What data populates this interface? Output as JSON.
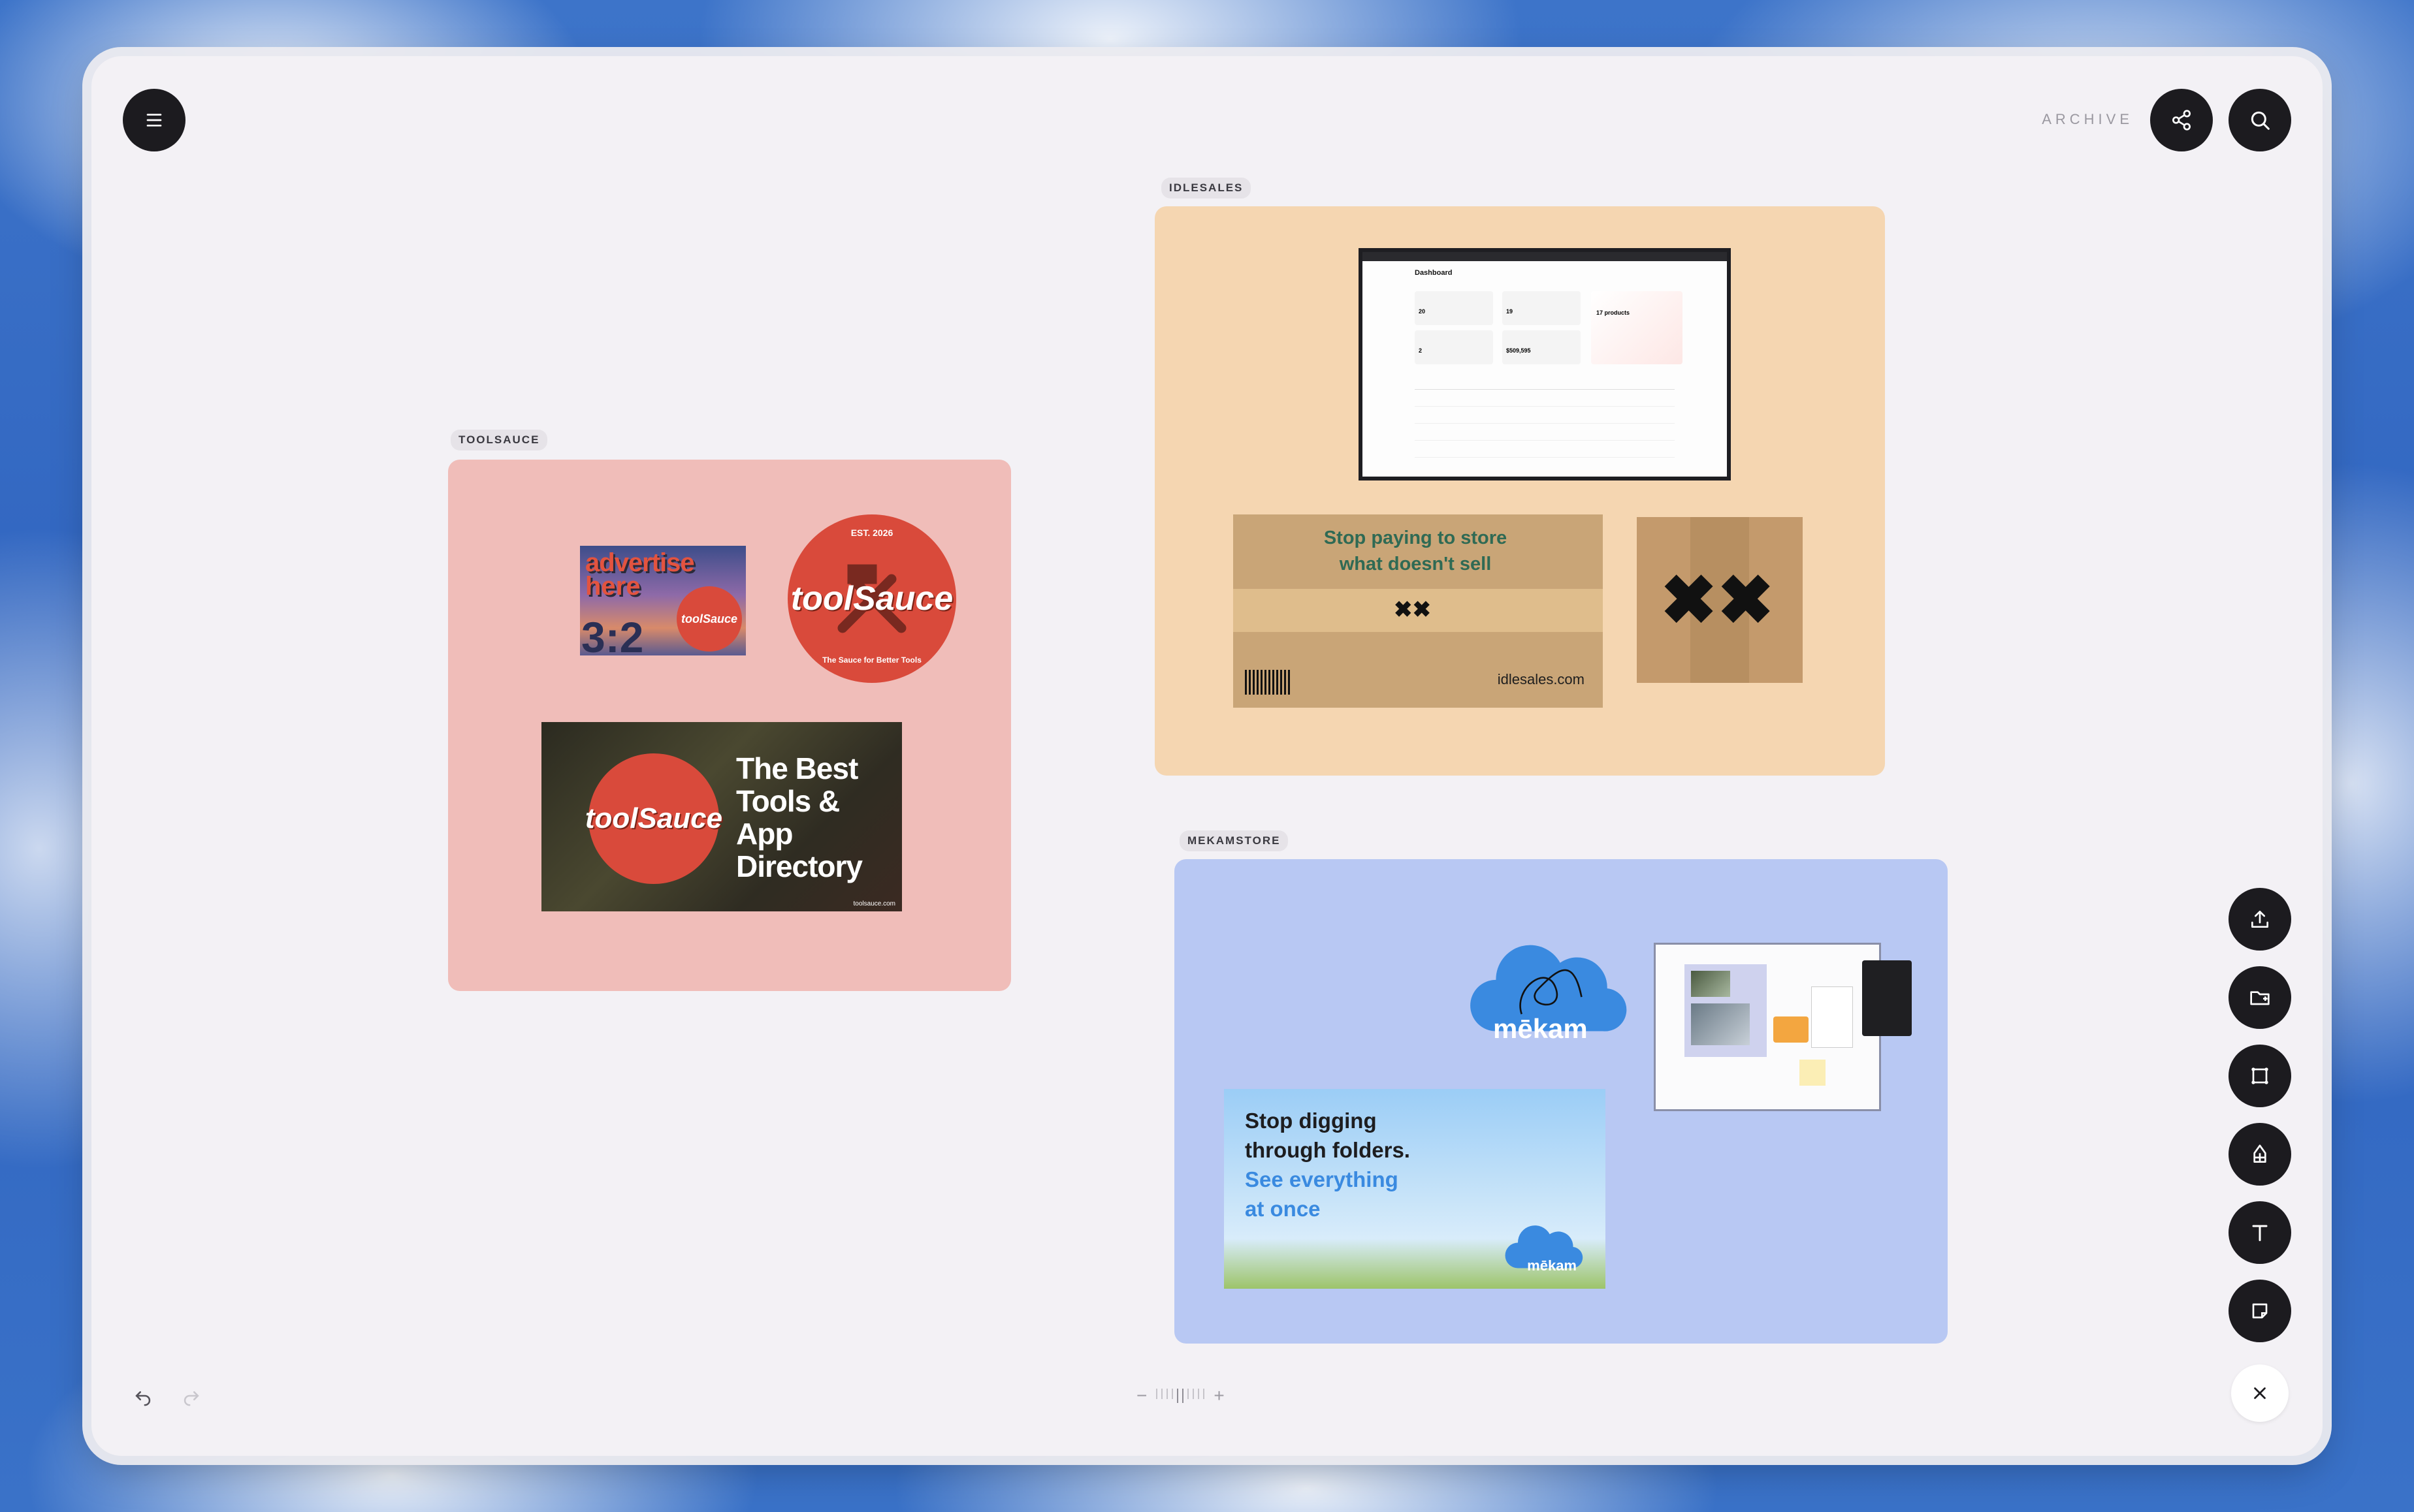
{
  "header": {
    "archive_label": "ARCHIVE"
  },
  "boards": [
    {
      "tag": "TOOLSAUCE",
      "color": "#f0bdb9"
    },
    {
      "tag": "IDLESALES",
      "color": "#f5d6b1"
    },
    {
      "tag": "MEKAMSTORE",
      "color": "#b8c8f3"
    }
  ],
  "toolsauce": {
    "ad_line1": "advertise",
    "ad_line2": "here",
    "ad_ratio": "3:2",
    "badge_est": "EST. 2026",
    "badge_name": "toolSauce",
    "badge_tagline": "The Sauce for Better Tools",
    "banner_line1": "The Best",
    "banner_line2": "Tools &",
    "banner_line3": "App",
    "banner_line4": "Directory",
    "banner_url": "toolsauce.com"
  },
  "idlesales": {
    "dash_title": "Dashboard",
    "stat1": "20",
    "stat2": "19",
    "stat3": "2",
    "stat4": "$509,595",
    "promo_title": "17 products",
    "box_line1": "Stop paying to store",
    "box_line2": "what doesn't sell",
    "box_url": "idlesales.com"
  },
  "mekam": {
    "logo": "mēkam",
    "ad_line1": "Stop digging",
    "ad_line2": "through folders.",
    "ad_line3": "See everything",
    "ad_line4": "at once",
    "ad_logo": "mēkam"
  },
  "colors": {
    "accent_dark": "#1c1b1f",
    "bg": "#f3f1f5",
    "red": "#d94a3b",
    "mekam_blue": "#3a8ae0"
  }
}
